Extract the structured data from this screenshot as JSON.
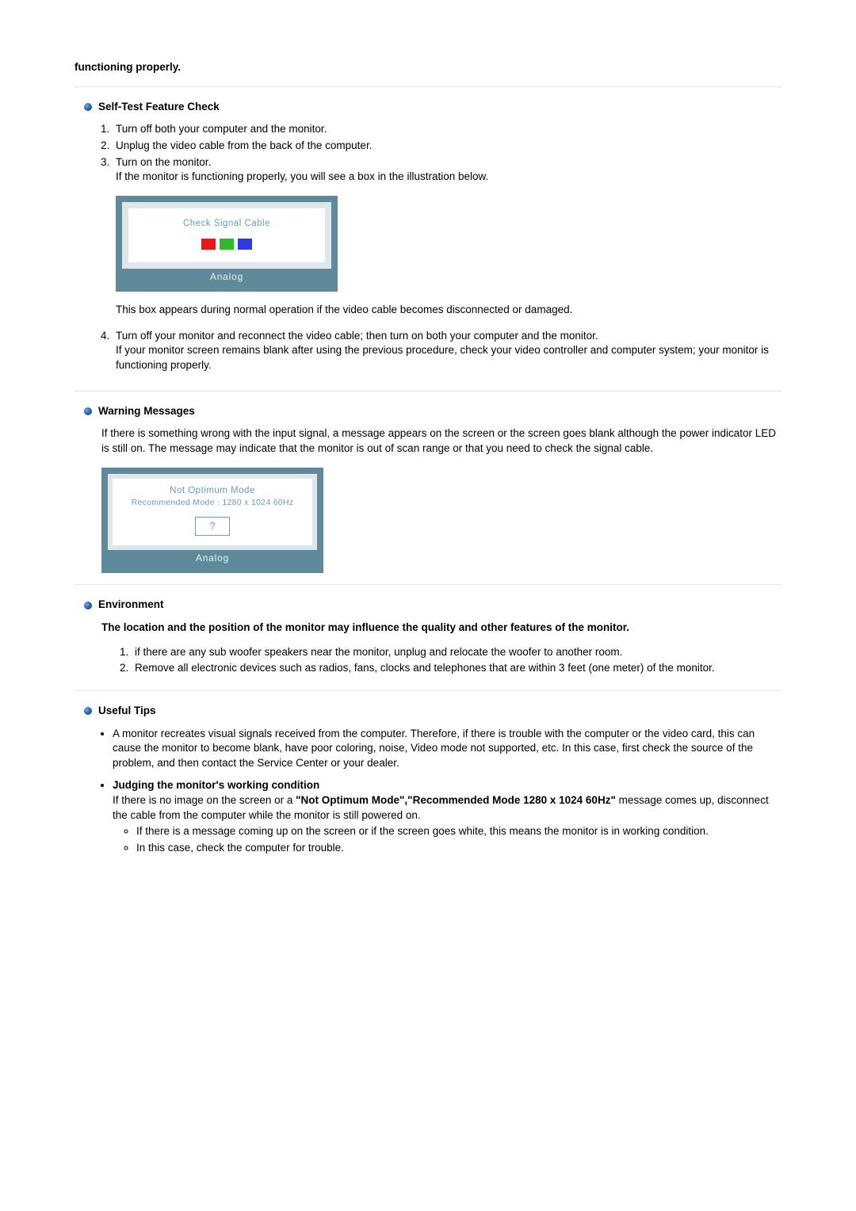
{
  "intro_bold": "functioning properly.",
  "sections": {
    "self_test": {
      "heading": "Self-Test Feature Check",
      "steps": {
        "s1": "Turn off both your computer and the monitor.",
        "s2": "Unplug the video cable from the back of the computer.",
        "s3a": "Turn on the monitor.",
        "s3b": "If the monitor is functioning properly, you will see a box in the illustration below.",
        "box1_text": "Check Signal Cable",
        "box1_footer": "Analog",
        "s3_after": "This box appears during normal operation if the video cable becomes disconnected or damaged.",
        "s4a": "Turn off your monitor and reconnect the video cable; then turn on both your computer and the monitor.",
        "s4b": "If your monitor screen remains blank after using the previous procedure, check your video controller and computer system; your monitor is functioning properly."
      }
    },
    "warning": {
      "heading": "Warning Messages",
      "body": "If there is something wrong with the input signal, a message appears on the screen or the screen goes blank although the power indicator LED is still on. The message may indicate that the monitor is out of scan range or that you need to check the signal cable.",
      "box2_line1": "Not Optimum Mode",
      "box2_line2": "Recommended Mode : 1280 x 1024  60Hz",
      "box2_q": "?",
      "box2_footer": "Analog"
    },
    "environment": {
      "heading": "Environment",
      "intro": "The location and the position of the monitor may influence the quality and other features of the monitor.",
      "e1": "if there are any sub woofer speakers near the monitor, unplug and relocate the woofer to another room.",
      "e2": "Remove all electronic devices such as radios, fans, clocks and telephones that are within 3 feet (one meter) of the monitor."
    },
    "tips": {
      "heading": "Useful Tips",
      "t1": "A monitor recreates visual signals received from the computer. Therefore, if there is trouble with the computer or the video card, this can cause the monitor to become blank, have poor coloring, noise, Video mode not supported, etc. In this case, first check the source of the problem, and then contact the Service Center or your dealer.",
      "t2_title": "Judging the monitor's working condition",
      "t2_body_pre": "If there is no image on the screen or a ",
      "t2_body_bold": "\"Not Optimum Mode\",\"Recommended Mode 1280 x 1024 60Hz\"",
      "t2_body_post": " message comes up, disconnect the cable from the computer while the monitor is still powered on.",
      "t2_sub1": "If there is a message coming up on the screen or if the screen goes white, this means the monitor is in working condition.",
      "t2_sub2": "In this case, check the computer for trouble."
    }
  }
}
